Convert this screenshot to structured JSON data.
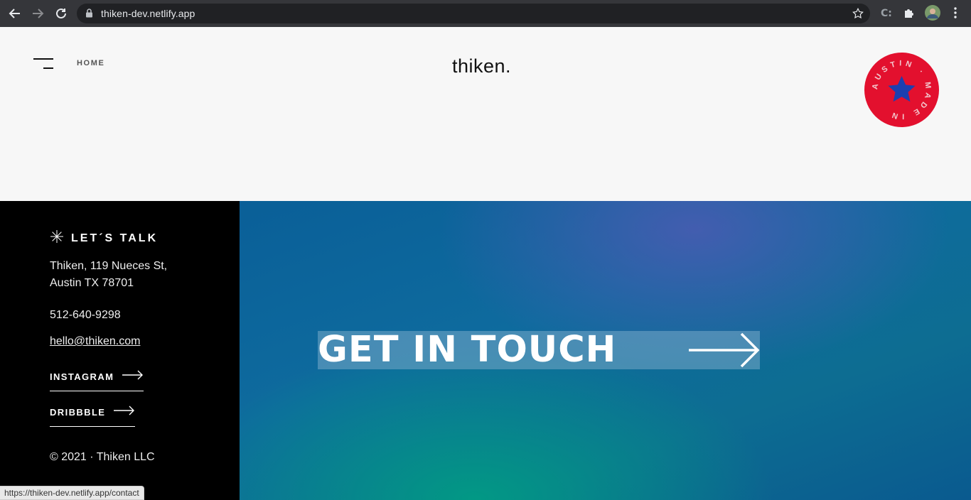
{
  "browser": {
    "url": "thiken-dev.netlify.app",
    "status_url": "https://thiken-dev.netlify.app/contact"
  },
  "header": {
    "nav_home": "HOME",
    "logo": "thiken.",
    "badge_text": "AUSTIN · MADE IN"
  },
  "footer": {
    "lets_talk": "LET´S TALK",
    "address_line1": "Thiken, 119 Nueces St,",
    "address_line2": "Austin TX 78701",
    "phone": "512-640-9298",
    "email": "hello@thiken.com",
    "instagram": "INSTAGRAM",
    "dribbble": "DRIBBBLE",
    "copyright": "© 2021 · Thiken LLC"
  },
  "cta": {
    "label": "GET IN TOUCH"
  },
  "colors": {
    "badge_red": "#e3102e",
    "badge_star": "#1c3fb0",
    "footer_bg": "#000000"
  }
}
